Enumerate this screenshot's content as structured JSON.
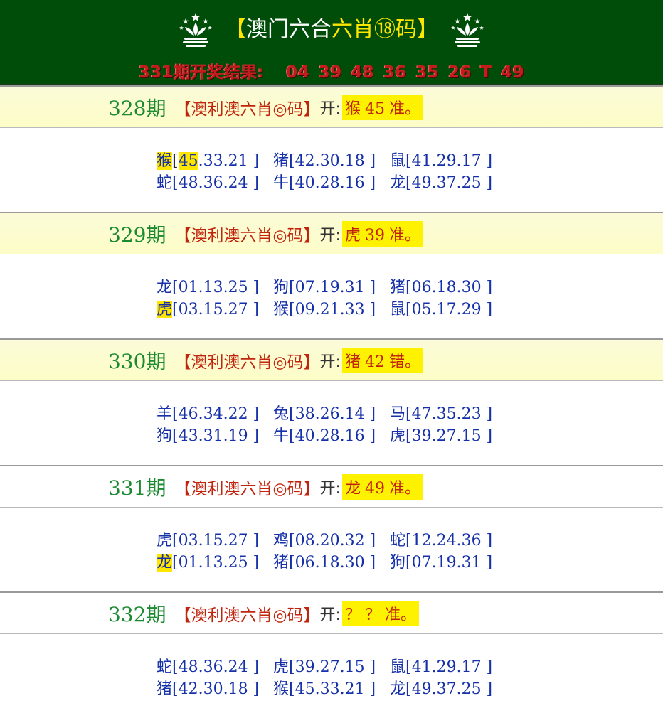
{
  "header": {
    "title_open": "【",
    "title_part1": "澳门六合",
    "title_part2": "六肖⑱码",
    "title_close": "】",
    "result_label": "331期开奖结果:",
    "result_numbers": [
      "04",
      "39",
      "48",
      "36",
      "35",
      "26",
      "T",
      "49"
    ]
  },
  "periods": [
    {
      "number": "328期",
      "label": "【澳利澳六肖◎码】",
      "open_label": "开:",
      "result_zodiac": "猴",
      "result_number": "45",
      "result_status": "准。",
      "rows": [
        [
          {
            "z": "猴",
            "n1": "45",
            "rest": ".33.21 ]",
            "hlz": true,
            "hln": true
          },
          {
            "z": "猪",
            "rest": "[42.30.18 ]"
          },
          {
            "z": "鼠",
            "rest": "[41.29.17 ]"
          }
        ],
        [
          {
            "z": "蛇",
            "rest": "[48.36.24 ]"
          },
          {
            "z": "牛",
            "rest": "[40.28.16 ]"
          },
          {
            "z": "龙",
            "rest": "[49.37.25 ]"
          }
        ]
      ]
    },
    {
      "number": "329期",
      "label": "【澳利澳六肖◎码】",
      "open_label": "开:",
      "result_zodiac": "虎",
      "result_number": "39",
      "result_status": "准。",
      "rows": [
        [
          {
            "z": "龙",
            "rest": "[01.13.25 ]"
          },
          {
            "z": "狗",
            "rest": "[07.19.31 ]"
          },
          {
            "z": "猪",
            "rest": "[06.18.30 ]"
          }
        ],
        [
          {
            "z": "虎",
            "rest": "[03.15.27 ]",
            "hlz": true
          },
          {
            "z": "猴",
            "rest": "[09.21.33 ]"
          },
          {
            "z": "鼠",
            "rest": "[05.17.29 ]"
          }
        ]
      ]
    },
    {
      "number": "330期",
      "label": "【澳利澳六肖◎码】",
      "open_label": "开:",
      "result_zodiac": "猪",
      "result_number": "42",
      "result_status": "错。",
      "rows": [
        [
          {
            "z": "羊",
            "rest": "[46.34.22 ]"
          },
          {
            "z": "兔",
            "rest": "[38.26.14 ]"
          },
          {
            "z": "马",
            "rest": "[47.35.23 ]"
          }
        ],
        [
          {
            "z": "狗",
            "rest": "[43.31.19 ]"
          },
          {
            "z": "牛",
            "rest": "[40.28.16 ]"
          },
          {
            "z": "虎",
            "rest": "[39.27.15 ]"
          }
        ]
      ]
    },
    {
      "number": "331期",
      "label": "【澳利澳六肖◎码】",
      "open_label": "开:",
      "result_zodiac": "龙",
      "result_number": "49",
      "result_status": "准。",
      "rows": [
        [
          {
            "z": "虎",
            "rest": "[03.15.27 ]"
          },
          {
            "z": "鸡",
            "rest": "[08.20.32 ]"
          },
          {
            "z": "蛇",
            "rest": "[12.24.36 ]"
          }
        ],
        [
          {
            "z": "龙",
            "rest": "[01.13.25 ]",
            "hlz": true
          },
          {
            "z": "猪",
            "rest": "[06.18.30 ]"
          },
          {
            "z": "狗",
            "rest": "[07.19.31 ]"
          }
        ]
      ]
    },
    {
      "number": "332期",
      "label": "【澳利澳六肖◎码】",
      "open_label": "开:",
      "result_zodiac": "？",
      "result_number": "？",
      "result_status": "准。",
      "rows": [
        [
          {
            "z": "蛇",
            "rest": "[48.36.24 ]"
          },
          {
            "z": "虎",
            "rest": "[39.27.15 ]"
          },
          {
            "z": "鼠",
            "rest": "[41.29.17 ]"
          }
        ],
        [
          {
            "z": "猪",
            "rest": "[42.30.18 ]"
          },
          {
            "z": "猴",
            "rest": "[45.33.21 ]"
          },
          {
            "z": "龙",
            "rest": "[49.37.25 ]"
          }
        ]
      ]
    }
  ],
  "colors": {
    "header_bg": "#004d0a",
    "period_number": "#1b8a31",
    "label_red": "#c0240c",
    "zodiac_blue": "#1530a8",
    "highlight": "#ffe600"
  }
}
